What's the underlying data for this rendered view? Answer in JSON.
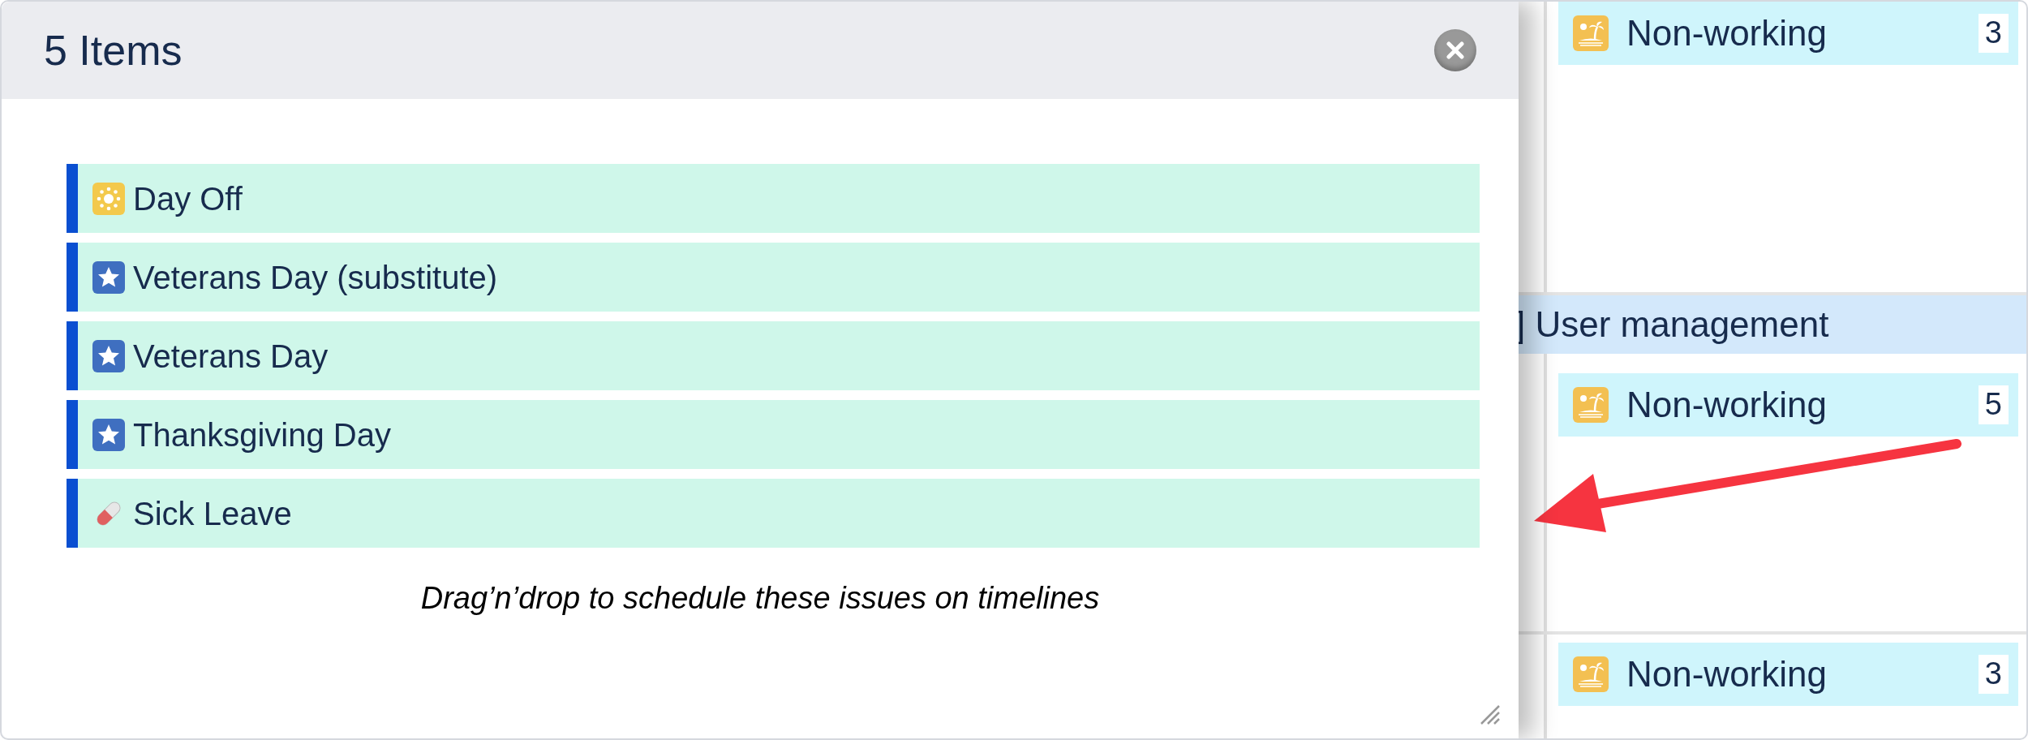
{
  "dialog": {
    "title": "5 Items",
    "items": [
      {
        "label": "Day Off",
        "kind": "sun"
      },
      {
        "label": "Veterans Day (substitute)",
        "kind": "star"
      },
      {
        "label": "Veterans Day",
        "kind": "star"
      },
      {
        "label": "Thanksgiving Day",
        "kind": "star"
      },
      {
        "label": "Sick Leave",
        "kind": "pill"
      }
    ],
    "hint": "Drag’n’drop to schedule these issues on timelines"
  },
  "background": {
    "group_header": "] User management",
    "cards": [
      {
        "label": "Non-working",
        "count": "3"
      },
      {
        "label": "Non-working",
        "count": "5"
      },
      {
        "label": "Non-working",
        "count": "3"
      }
    ]
  }
}
